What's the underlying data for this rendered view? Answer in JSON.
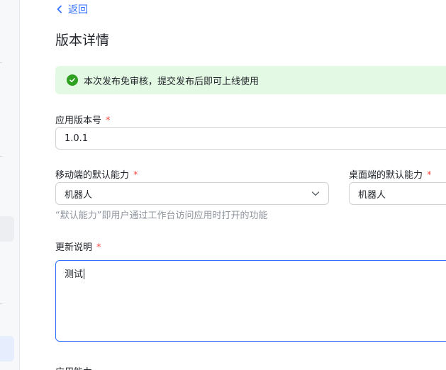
{
  "nav": {
    "back_label": "返回"
  },
  "page": {
    "title": "版本详情"
  },
  "notice": {
    "text": "本次发布免审核，提交发布后即可上线使用"
  },
  "form": {
    "version": {
      "label": "应用版本号",
      "required_mark": "*",
      "value": "1.0.1"
    },
    "mobile_default": {
      "label": "移动端的默认能力",
      "required_mark": "*",
      "value": "机器人"
    },
    "desktop_default": {
      "label": "桌面端的默认能力",
      "required_mark": "*",
      "value": "机器人"
    },
    "default_hint": "“默认能力”即用户通过工作台访问应用时打开的功能",
    "release_notes": {
      "label": "更新说明",
      "required_mark": "*",
      "value": "测试"
    },
    "next_section_label": "应用能力"
  },
  "colors": {
    "accent": "#3370ff",
    "success": "#2ea121",
    "notice_bg": "#e4f9e4",
    "required": "#f54a45"
  }
}
